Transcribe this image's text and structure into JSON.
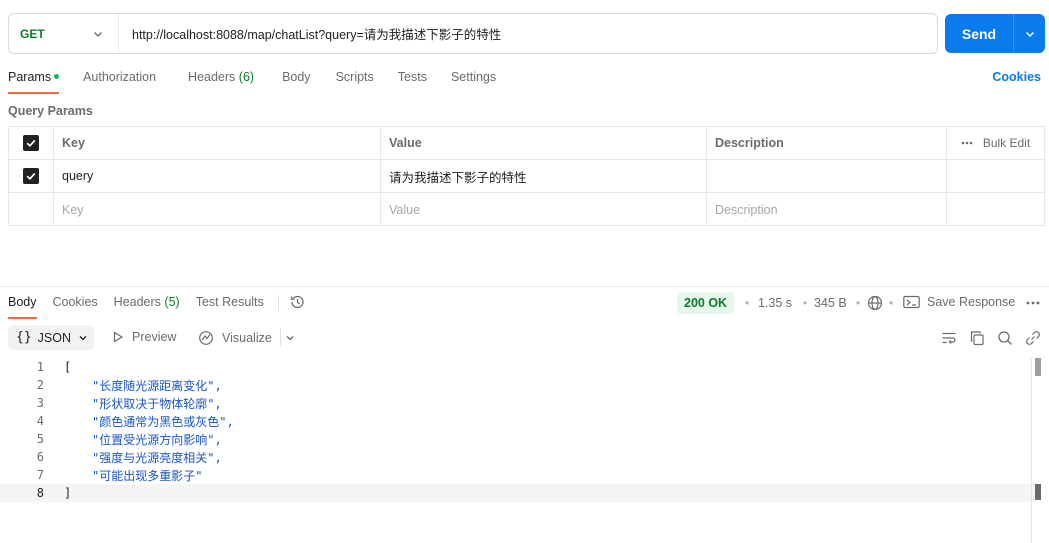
{
  "request": {
    "method": "GET",
    "url": "http://localhost:8088/map/chatList?query=请为我描述下影子的特性",
    "send_label": "Send"
  },
  "request_tabs": [
    {
      "label": "Params"
    },
    {
      "label": "Authorization"
    },
    {
      "label": "Headers",
      "count": "(6)"
    },
    {
      "label": "Body"
    },
    {
      "label": "Scripts"
    },
    {
      "label": "Tests"
    },
    {
      "label": "Settings"
    }
  ],
  "cookies_link": "Cookies",
  "query_params": {
    "section_label": "Query Params",
    "headers": {
      "key": "Key",
      "value": "Value",
      "description": "Description",
      "bulk_edit": "Bulk Edit"
    },
    "rows": [
      {
        "key": "query",
        "value": "请为我描述下影子的特性",
        "description": "",
        "checked": true
      }
    ],
    "placeholders": {
      "key": "Key",
      "value": "Value",
      "description": "Description"
    }
  },
  "response_tabs": [
    {
      "label": "Body"
    },
    {
      "label": "Cookies"
    },
    {
      "label": "Headers",
      "count": "(5)"
    },
    {
      "label": "Test Results"
    }
  ],
  "response_meta": {
    "status": "200 OK",
    "time": "1.35 s",
    "size": "345 B",
    "save_label": "Save Response"
  },
  "viewer": {
    "format": "JSON",
    "preview": "Preview",
    "visualize": "Visualize"
  },
  "response_lines": [
    {
      "n": "1",
      "text": "["
    },
    {
      "n": "2",
      "text": "\"长度随光源距离变化\","
    },
    {
      "n": "3",
      "text": "\"形状取决于物体轮廓\","
    },
    {
      "n": "4",
      "text": "\"颜色通常为黑色或灰色\","
    },
    {
      "n": "5",
      "text": "\"位置受光源方向影响\","
    },
    {
      "n": "6",
      "text": "\"强度与光源亮度相关\","
    },
    {
      "n": "7",
      "text": "\"可能出现多重影子\""
    },
    {
      "n": "8",
      "text": "]"
    }
  ],
  "colors": {
    "accent": "#097bed",
    "tab_indicator": "#f26b3a",
    "status_ok": "#0f7a2d",
    "json_string": "#1a55c8"
  }
}
